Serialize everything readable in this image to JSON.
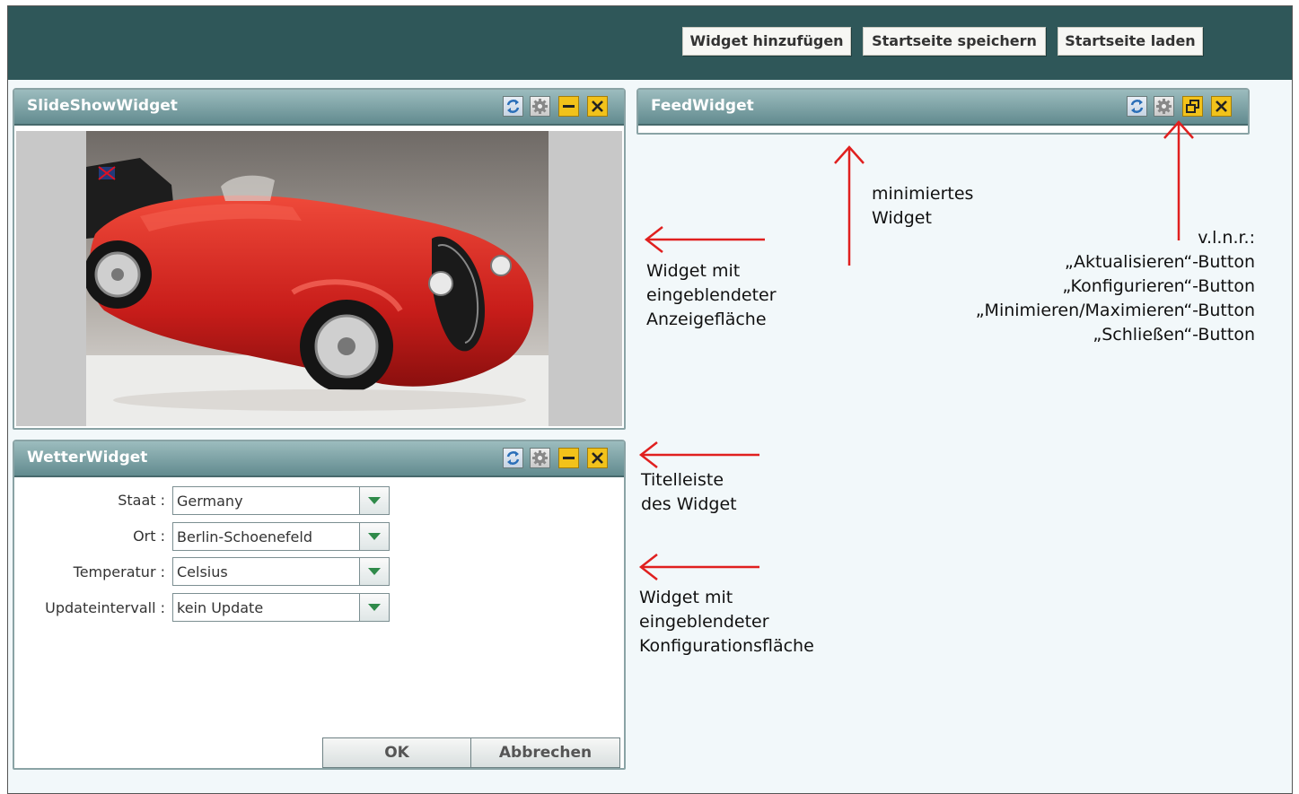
{
  "toolbar": {
    "add_widget": "Widget hinzufügen",
    "save_home": "Startseite speichern",
    "load_home": "Startseite laden"
  },
  "slideshow": {
    "title": "SlideShowWidget"
  },
  "feed": {
    "title": "FeedWidget"
  },
  "weather": {
    "title": "WetterWidget",
    "fields": [
      {
        "label": "Staat :",
        "value": "Germany"
      },
      {
        "label": "Ort :",
        "value": "Berlin-Schoenefeld"
      },
      {
        "label": "Temperatur :",
        "value": "Celsius"
      },
      {
        "label": "Updateintervall :",
        "value": "kein Update"
      }
    ],
    "ok": "OK",
    "cancel": "Abbrechen"
  },
  "annotations": {
    "minimized": [
      "minimiertes",
      "Widget"
    ],
    "display": [
      "Widget mit",
      "eingeblendeter",
      "Anzeigefläche"
    ],
    "buttons": [
      "v.l.n.r.:",
      "„Aktualisieren“-Button",
      "„Konfigurieren“-Button",
      "„Minimieren/Maximieren“-Button",
      "„Schließen“-Button"
    ],
    "titlebar": [
      "Titelleiste",
      "des Widget"
    ],
    "config": [
      "Widget mit",
      "eingeblendeter",
      "Konfigurationsfläche"
    ]
  },
  "colors": {
    "header_bg": "#2f5759",
    "titlebar": "#7fa3a6",
    "button_yellow": "#f2c21a",
    "arrow_red": "#e0201f",
    "car_red": "#d82a24"
  },
  "icons": [
    "refresh-icon",
    "gear-icon",
    "minimize-icon",
    "restore-icon",
    "close-icon",
    "chevron-down-icon"
  ]
}
